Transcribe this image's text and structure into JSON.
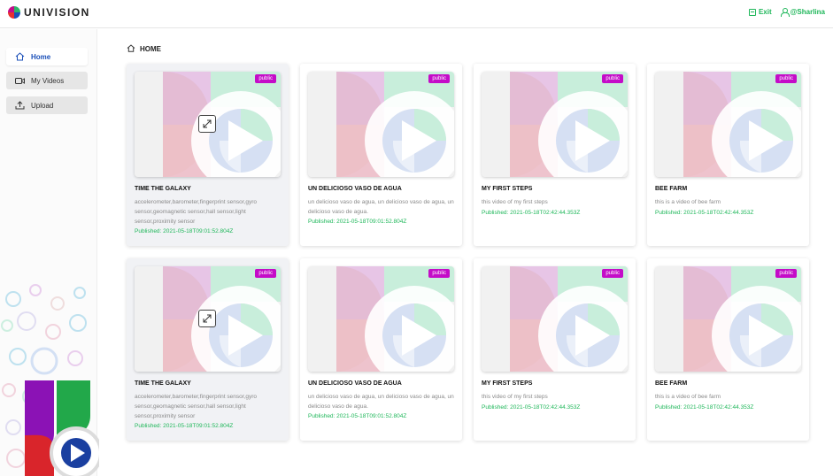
{
  "app": {
    "logo_text": "UNIVISION"
  },
  "header": {
    "exit_label": "Exit",
    "user_label": "@Sharlina"
  },
  "sidebar": {
    "items": [
      {
        "label": "Home",
        "icon": "home-icon"
      },
      {
        "label": "My Videos",
        "icon": "video-camera-icon"
      },
      {
        "label": "Upload",
        "icon": "upload-icon"
      }
    ]
  },
  "breadcrumb": {
    "label": "HOME"
  },
  "videos": [
    {
      "title": "TIME THE GALAXY",
      "description": "accelerometer,barometer,fingerprint sensor,gyro sensor,geomagnetic sensor,hall sensor,light sensor,proximity sensor",
      "published": "Published: 2021-05-18T09:01:52.804Z",
      "badge": "public"
    },
    {
      "title": "UN DELICIOSO VASO DE AGUA",
      "description": "un delicioso vaso de agua, un delicioso vaso de agua, un delicioso vaso de agua.",
      "published": "Published: 2021-05-18T09:01:52.804Z",
      "badge": "public"
    },
    {
      "title": "MY FIRST STEPS",
      "description": "this video of my first steps",
      "published": "Published: 2021-05-18T02:42:44.353Z",
      "badge": "public"
    },
    {
      "title": "BEE FARM",
      "description": "this is a video of bee farm",
      "published": "Published: 2021-05-18T02:42:44.353Z",
      "badge": "public"
    },
    {
      "title": "TIME THE GALAXY",
      "description": "accelerometer,barometer,fingerprint sensor,gyro sensor,geomagnetic sensor,hall sensor,light sensor,proximity sensor",
      "published": "Published: 2021-05-18T09:01:52.804Z",
      "badge": "public"
    },
    {
      "title": "UN DELICIOSO VASO DE AGUA",
      "description": "un delicioso vaso de agua, un delicioso vaso de agua, un delicioso vaso de agua.",
      "published": "Published: 2021-05-18T09:01:52.804Z",
      "badge": "public"
    },
    {
      "title": "MY FIRST STEPS",
      "description": "this video of my first steps",
      "published": "Published: 2021-05-18T02:42:44.353Z",
      "badge": "public"
    },
    {
      "title": "BEE FARM",
      "description": "this is a video of bee farm",
      "published": "Published: 2021-05-18T02:42:44.353Z",
      "badge": "public"
    }
  ],
  "colors": {
    "accent_green": "#1fb75a",
    "brand_blue": "#1a4fb8",
    "badge_magenta": "#c40cc8"
  }
}
